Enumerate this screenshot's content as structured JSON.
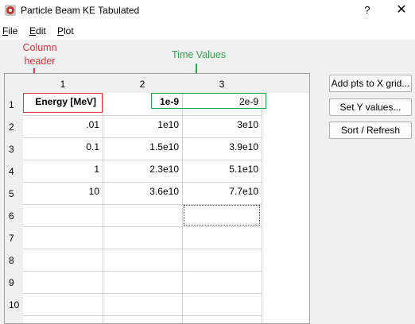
{
  "window": {
    "title": "Particle Beam KE Tabulated",
    "help_label": "?",
    "close_label": "✕",
    "icon": "app-logo-icon"
  },
  "menu": {
    "file_first": "F",
    "file_rest": "ile",
    "edit_first": "E",
    "edit_rest": "dit",
    "plot_first": "P",
    "plot_rest": "lot"
  },
  "annotations": {
    "column_header_line1": "Column",
    "column_header_line2": "header",
    "time_values": "Time Values",
    "red_color": "#e0323c",
    "green_color": "#2ca34a"
  },
  "table": {
    "col_headers": [
      "1",
      "2",
      "3"
    ],
    "row_headers": [
      "1",
      "2",
      "3",
      "4",
      "5",
      "6",
      "7",
      "8",
      "9",
      "10"
    ],
    "rows": [
      [
        "Energy [MeV]",
        "1e-9",
        "2e-9"
      ],
      [
        ".01",
        "1e10",
        "3e10"
      ],
      [
        "0.1",
        "1.5e10",
        "3.9e10"
      ],
      [
        "1",
        "2.3e10",
        "5.1e10"
      ],
      [
        "10",
        "3.6e10",
        "7.7e10"
      ],
      [
        "",
        "",
        ""
      ],
      [
        "",
        "",
        ""
      ],
      [
        "",
        "",
        ""
      ],
      [
        "",
        "",
        ""
      ],
      [
        "",
        "",
        ""
      ]
    ]
  },
  "buttons": {
    "add_pts": "Add pts to X grid...",
    "set_y": "Set Y values...",
    "sort_refresh": "Sort / Refresh"
  }
}
